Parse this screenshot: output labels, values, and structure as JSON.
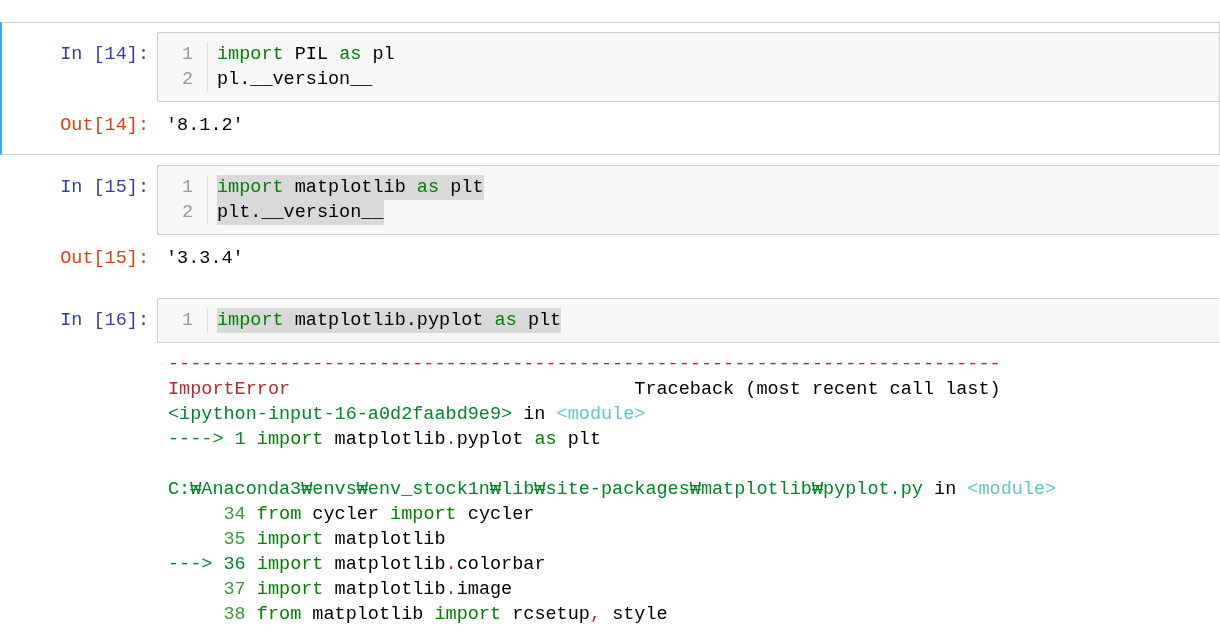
{
  "cells": [
    {
      "selected": true,
      "prompt": "In [14]:",
      "lines": [
        {
          "number": "1",
          "highlighted": false,
          "tokens": [
            {
              "text": "import",
              "kind": "kw"
            },
            {
              "text": " PIL ",
              "kind": "plain"
            },
            {
              "text": "as",
              "kind": "kw"
            },
            {
              "text": " pl",
              "kind": "plain"
            }
          ]
        },
        {
          "number": "2",
          "highlighted": false,
          "tokens": [
            {
              "text": "pl.__version__",
              "kind": "plain"
            }
          ]
        }
      ],
      "output": {
        "kind": "result",
        "prompt": "Out[14]:",
        "text": "'8.1.2'"
      }
    },
    {
      "selected": false,
      "prompt": "In [15]:",
      "lines": [
        {
          "number": "1",
          "highlighted": true,
          "tokens": [
            {
              "text": "import",
              "kind": "kw"
            },
            {
              "text": " matplotlib ",
              "kind": "plain"
            },
            {
              "text": "as",
              "kind": "kw"
            },
            {
              "text": " plt",
              "kind": "plain"
            }
          ]
        },
        {
          "number": "2",
          "highlighted": true,
          "tokens": [
            {
              "text": "plt.__version__",
              "kind": "plain"
            }
          ]
        }
      ],
      "output": {
        "kind": "result",
        "prompt": "Out[15]:",
        "text": "'3.3.4'"
      }
    },
    {
      "selected": false,
      "prompt": "In [16]:",
      "lines": [
        {
          "number": "1",
          "highlighted": true,
          "tokens": [
            {
              "text": "import",
              "kind": "kw"
            },
            {
              "text": " matplotlib.pyplot ",
              "kind": "plain"
            },
            {
              "text": "as",
              "kind": "kw"
            },
            {
              "text": " plt",
              "kind": "plain"
            }
          ]
        }
      ],
      "output": {
        "kind": "error",
        "blocks": [
          [
            [
              {
                "text": "---------------------------------------------------------------------------",
                "kind": "err"
              }
            ],
            [
              {
                "text": "ImportError",
                "kind": "err"
              },
              {
                "text": "                               Traceback (most recent call last)",
                "kind": "plain"
              }
            ],
            [
              {
                "text": "<ipython-input-16-a0d2faabd9e9>",
                "kind": "path"
              },
              {
                "text": " in ",
                "kind": "plain"
              },
              {
                "text": "<module>",
                "kind": "module"
              }
            ],
            [
              {
                "text": "----> 1 ",
                "kind": "path"
              },
              {
                "text": "import",
                "kind": "kw"
              },
              {
                "text": " matplotlib",
                "kind": "plain"
              },
              {
                "text": ".",
                "kind": "err"
              },
              {
                "text": "pyplot ",
                "kind": "plain"
              },
              {
                "text": "as",
                "kind": "kw"
              },
              {
                "text": " plt",
                "kind": "plain"
              }
            ]
          ],
          [
            [
              {
                "text": "C:₩Anaconda3₩envs₩env_stock1n₩lib₩site-packages₩matplotlib₩pyplot.py",
                "kind": "path"
              },
              {
                "text": " in ",
                "kind": "plain"
              },
              {
                "text": "<module>",
                "kind": "module"
              }
            ],
            [
              {
                "text": "     34 ",
                "kind": "lineno"
              },
              {
                "text": "from",
                "kind": "kw"
              },
              {
                "text": " cycler ",
                "kind": "plain"
              },
              {
                "text": "import",
                "kind": "kw"
              },
              {
                "text": " cycler",
                "kind": "plain"
              }
            ],
            [
              {
                "text": "     35 ",
                "kind": "lineno"
              },
              {
                "text": "import",
                "kind": "kw"
              },
              {
                "text": " matplotlib",
                "kind": "plain"
              }
            ],
            [
              {
                "text": "---> 36 ",
                "kind": "path"
              },
              {
                "text": "import",
                "kind": "kw"
              },
              {
                "text": " matplotlib",
                "kind": "plain"
              },
              {
                "text": ".",
                "kind": "err"
              },
              {
                "text": "colorbar",
                "kind": "plain"
              }
            ],
            [
              {
                "text": "     37 ",
                "kind": "lineno"
              },
              {
                "text": "import",
                "kind": "kw"
              },
              {
                "text": " matplotlib",
                "kind": "plain"
              },
              {
                "text": ".",
                "kind": "err"
              },
              {
                "text": "image",
                "kind": "plain"
              }
            ],
            [
              {
                "text": "     38 ",
                "kind": "lineno"
              },
              {
                "text": "from",
                "kind": "kw"
              },
              {
                "text": " matplotlib ",
                "kind": "plain"
              },
              {
                "text": "import",
                "kind": "kw"
              },
              {
                "text": " rcsetup",
                "kind": "plain"
              },
              {
                "text": ",",
                "kind": "err"
              },
              {
                "text": " style",
                "kind": "plain"
              }
            ]
          ]
        ]
      }
    }
  ]
}
